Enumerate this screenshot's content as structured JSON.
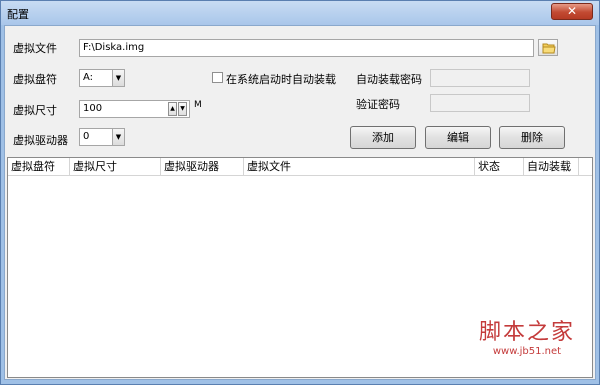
{
  "window": {
    "title": "配置",
    "close_glyph": "✕"
  },
  "form": {
    "vfile_label": "虚拟文件",
    "vfile_value": "F:\\Diska.img",
    "disk_label": "虚拟盘符",
    "disk_value": "A:",
    "size_label": "虚拟尺寸",
    "size_value": "100",
    "size_unit": "M",
    "driver_label": "虚拟驱动器",
    "driver_value": "0",
    "autoload_label": "在系统启动时自动装载",
    "autoload_checked": false,
    "autopwd_label": "自动装载密码",
    "verify_label": "验证密码"
  },
  "buttons": {
    "add": "添加",
    "edit": "编辑",
    "delete": "删除"
  },
  "list": {
    "columns": [
      "虚拟盘符",
      "虚拟尺寸",
      "虚拟驱动器",
      "虚拟文件",
      "状态",
      "自动装载"
    ],
    "rows": []
  },
  "watermark": {
    "main": "脚本之家",
    "sub": "www.jb51.net"
  },
  "colors": {
    "title_bar": "#a9c6ea",
    "close_button": "#c24a32",
    "watermark": "#c43b3b"
  }
}
